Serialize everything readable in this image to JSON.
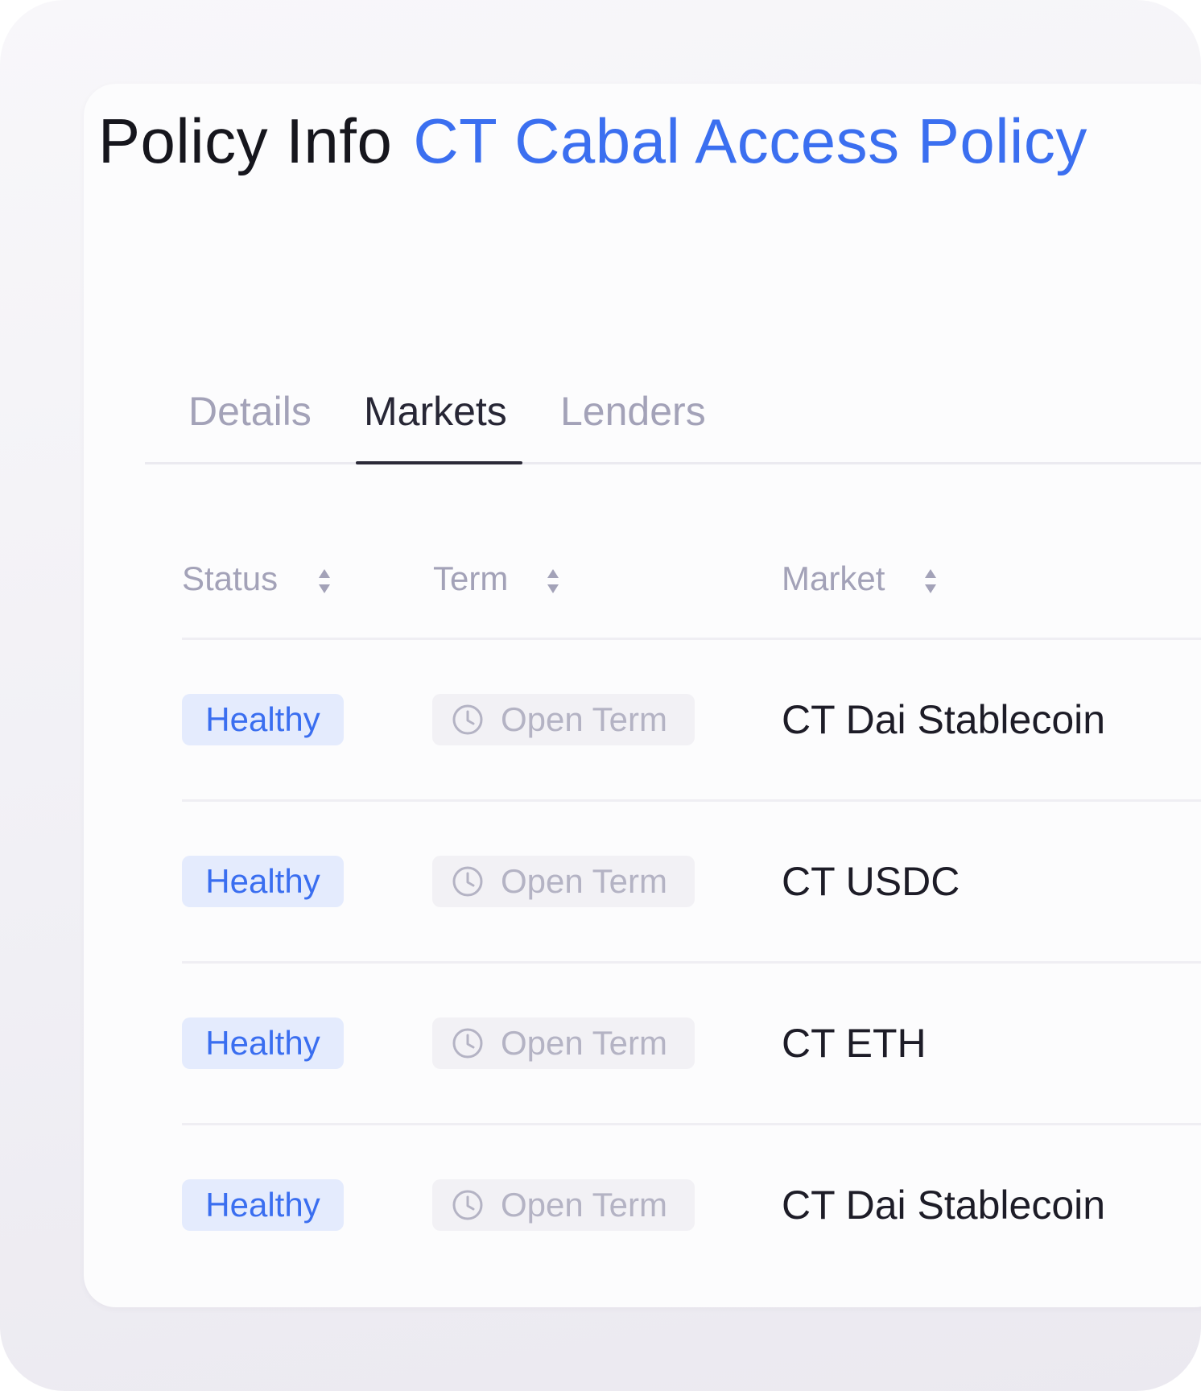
{
  "header": {
    "title": "Policy Info",
    "policy_name": "CT Cabal Access Policy"
  },
  "tabs": [
    {
      "label": "Details",
      "active": false
    },
    {
      "label": "Markets",
      "active": true
    },
    {
      "label": "Lenders",
      "active": false
    }
  ],
  "table": {
    "columns": [
      {
        "label": "Status",
        "sort_icon": "sort-icon"
      },
      {
        "label": "Term",
        "sort_icon": "sort-icon"
      },
      {
        "label": "Market",
        "sort_icon": "sort-icon"
      }
    ],
    "rows": [
      {
        "status": "Healthy",
        "term": "Open Term",
        "market": "CT Dai Stablecoin"
      },
      {
        "status": "Healthy",
        "term": "Open Term",
        "market": "CT USDC"
      },
      {
        "status": "Healthy",
        "term": "Open Term",
        "market": "CT ETH"
      },
      {
        "status": "Healthy",
        "term": "Open Term",
        "market": "CT Dai Stablecoin"
      }
    ]
  },
  "colors": {
    "accent": "#3b6ff0",
    "status_healthy_bg": "#e4ebfd",
    "term_badge_bg": "#f2f1f5"
  },
  "icons": {
    "sort": "sort-icon",
    "term": "clock-icon"
  }
}
